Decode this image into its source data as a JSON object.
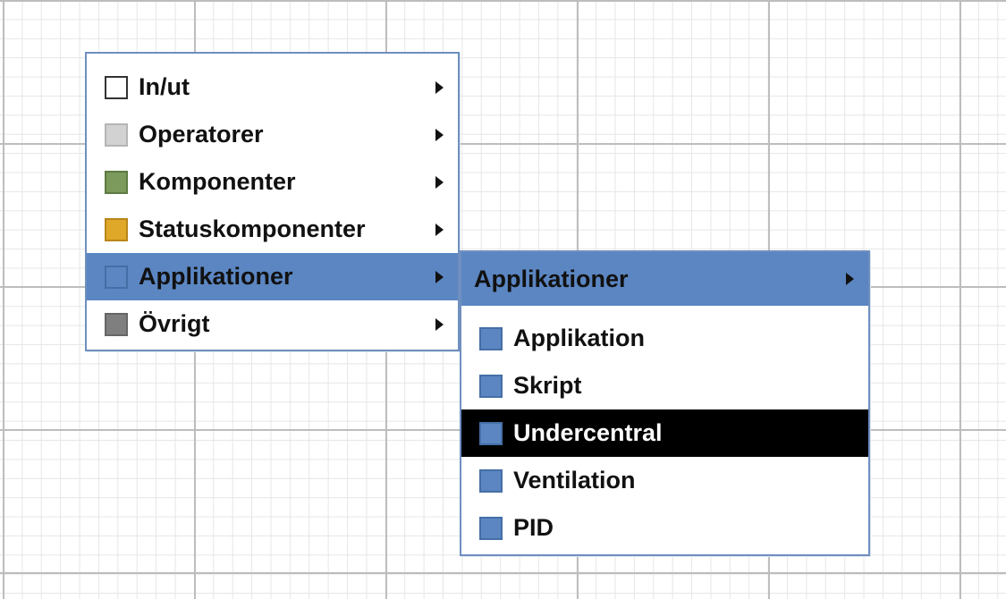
{
  "main_menu": {
    "items": [
      {
        "label": "In/ut",
        "swatch_color": "#ffffff",
        "swatch_border": "#333333",
        "has_submenu": true
      },
      {
        "label": "Operatorer",
        "swatch_color": "#d2d2d2",
        "swatch_border": "#b5b5b5",
        "has_submenu": true
      },
      {
        "label": "Komponenter",
        "swatch_color": "#7b9a5b",
        "swatch_border": "#5d7a43",
        "has_submenu": true
      },
      {
        "label": "Statuskomponenter",
        "swatch_color": "#e0a828",
        "swatch_border": "#b9861b",
        "has_submenu": true
      },
      {
        "label": "Applikationer",
        "swatch_color": "#5b86c2",
        "swatch_border": "#456ea6",
        "has_submenu": true,
        "state": "hover"
      },
      {
        "label": "Övrigt",
        "swatch_color": "#7f7f7f",
        "swatch_border": "#666666",
        "has_submenu": true
      }
    ]
  },
  "sub_menu": {
    "header": "Applikationer",
    "items": [
      {
        "label": "Applikation",
        "swatch_color": "#5b86c2",
        "swatch_border": "#456ea6"
      },
      {
        "label": "Skript",
        "swatch_color": "#5b86c2",
        "swatch_border": "#456ea6"
      },
      {
        "label": "Undercentral",
        "swatch_color": "#5b86c2",
        "swatch_border": "#456ea6",
        "state": "selected"
      },
      {
        "label": "Ventilation",
        "swatch_color": "#5b86c2",
        "swatch_border": "#456ea6"
      },
      {
        "label": "PID",
        "swatch_color": "#5b86c2",
        "swatch_border": "#456ea6"
      }
    ]
  },
  "colors": {
    "grid_major": "#bdbdbd",
    "grid_minor": "#e6e6e6",
    "menu_border": "#6f8fbf",
    "highlight": "#5b86c2",
    "selected_bg": "#000000",
    "selected_text": "#ffffff"
  },
  "icons": {
    "submenu_arrow": "triangle-right-icon"
  }
}
